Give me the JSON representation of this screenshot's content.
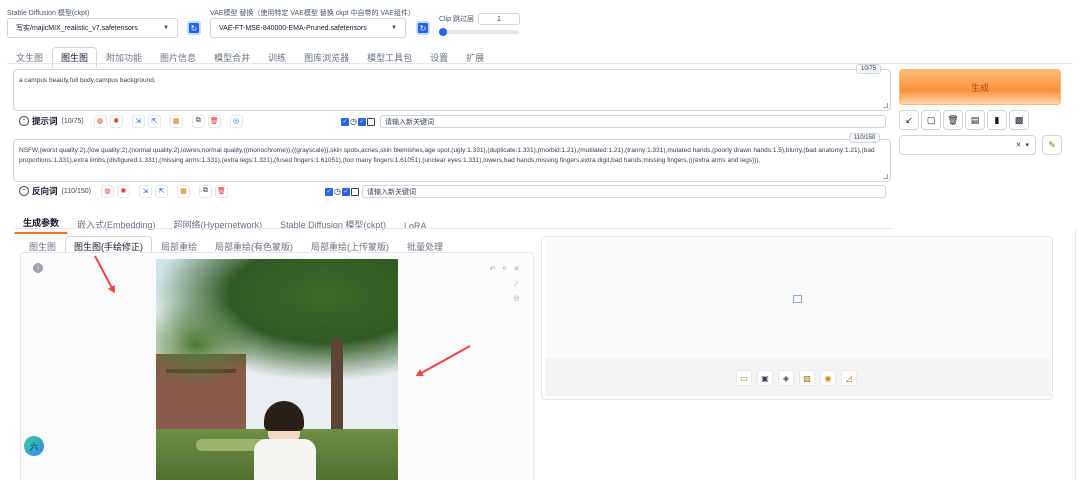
{
  "top": {
    "sd_model_label": "Stable Diffusion 模型(ckpt)",
    "sd_model_value": "写实/majicMIX_realistic_v7.safetensors",
    "vae_label": "VAE模型 替换（使用特定 VAE模型 替换 ckpt 中自带的 VAE组件）",
    "vae_value": "VAE-FT-MSE-840000-EMA-Pruned.safetensors",
    "clip_label": "Clip 跳过层",
    "clip_value": "1"
  },
  "main_tabs": [
    "文生图",
    "图生图",
    "附加功能",
    "图片信息",
    "模型合并",
    "训练",
    "图库浏览器",
    "模型工具包",
    "设置",
    "扩展"
  ],
  "prompt": {
    "text": "a campus beauty,full body,campus background,",
    "counter": "10/75",
    "label": "提示词",
    "count": "(10/75)",
    "keyword_placeholder": "请输入新关键词"
  },
  "negative": {
    "text": "NSFW,(worst quality:2),(low quality:2),(normal quality:2),lowres,normal quality,((monochrome)),((grayscale)),skin spots,acnes,skin blemishes,age spot,(ugly:1.331),(duplicate:1.331),(morbid:1.21),(mutilated:1.21),(tranny:1.331),mutated hands,(poorly drawn hands:1.5),blurry,(bad anatomy:1.21),(bad proportions:1.331),extra limbs,(disfigured:1.331),(missing arms:1.331),(extra legs:1.331),(fused fingers:1.61051),(too many fingers:1.61051),(unclear eyes:1.331),lowers,bad hands,missing fingers,extra digit,bad hands,missing fingers,(((extra arms and legs))),",
    "counter": "110/150",
    "label": "反向词",
    "count": "(110/150)",
    "keyword_placeholder": "请输入新关键词"
  },
  "generate_label": "生成",
  "param_tabs": [
    "生成参数",
    "嵌入式(Embedding)",
    "超网络(Hypernetwork)",
    "Stable Diffusion 模型(ckpt)",
    "LoRA"
  ],
  "img_tabs": [
    "图生图",
    "图生图(手绘修正)",
    "局部重绘",
    "局部重绘(有色蒙版)",
    "局部重绘(上传蒙版)",
    "批量处理"
  ],
  "floating_badge": "六",
  "colors": {
    "accent": "#2563eb",
    "generate": "#fb923c",
    "arrow": "#ef4444"
  }
}
